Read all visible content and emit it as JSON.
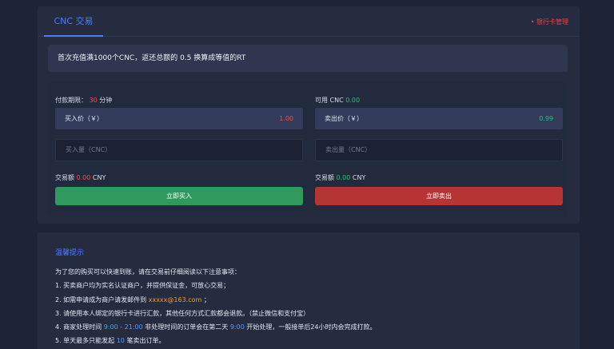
{
  "header": {
    "tab_label": "CNC 交易",
    "bank_link": "• 银行卡管理"
  },
  "notice": "首次充值满1000个CNC，返还总额的 0.5 换算成等值的RT",
  "buy": {
    "period_label": "付款期限：",
    "period_value": "30",
    "period_unit": "分钟",
    "price_label": "买入价（￥）",
    "price_value": "1.00",
    "qty_placeholder": "买入量（CNC）",
    "amount_label": "交易额",
    "amount_value": "0.00",
    "amount_unit": "CNY",
    "button": "立即买入"
  },
  "sell": {
    "available_label": "可用 CNC",
    "available_value": "0.00",
    "price_label": "卖出价（￥）",
    "price_value": "0.99",
    "qty_placeholder": "卖出量（CNC）",
    "amount_label": "交易额",
    "amount_value": "0.00",
    "amount_unit": "CNY",
    "button": "立即卖出"
  },
  "tips": {
    "title": "温馨提示",
    "intro": "为了您的购买可以快速到账，请在交易前仔细阅读以下注意事项：",
    "line1": "1. 买卖商户均为实名认证商户，并提供保证金，可放心交易；",
    "line2_pre": "2. 如需申请成为商户请发邮件到 ",
    "line2_email": "xxxxx@163.com",
    "line2_post": " ；",
    "line3": "3. 请使用本人绑定的银行卡进行汇款，其他任何方式汇款都会退款。（禁止微信和支付宝）",
    "line4_pre": "4. 商家处理时间 ",
    "line4_time": "9:00 - 21:00",
    "line4_mid": " 非处理时间的订单会在第二天 ",
    "line4_time2": "9:00",
    "line4_post": " 开始处理，一般接单后24小时内会完成打款。",
    "line5_pre": "5. 单天最多只能发起 ",
    "line5_count": "10",
    "line5_post": " 笔卖出订单。"
  },
  "colors": {
    "accent": "#4a7dff",
    "buy_green": "#2f9a5c",
    "sell_red": "#b53535",
    "price_red": "#ff4a4a",
    "price_green": "#27c27a",
    "email_orange": "#f09a2a"
  }
}
